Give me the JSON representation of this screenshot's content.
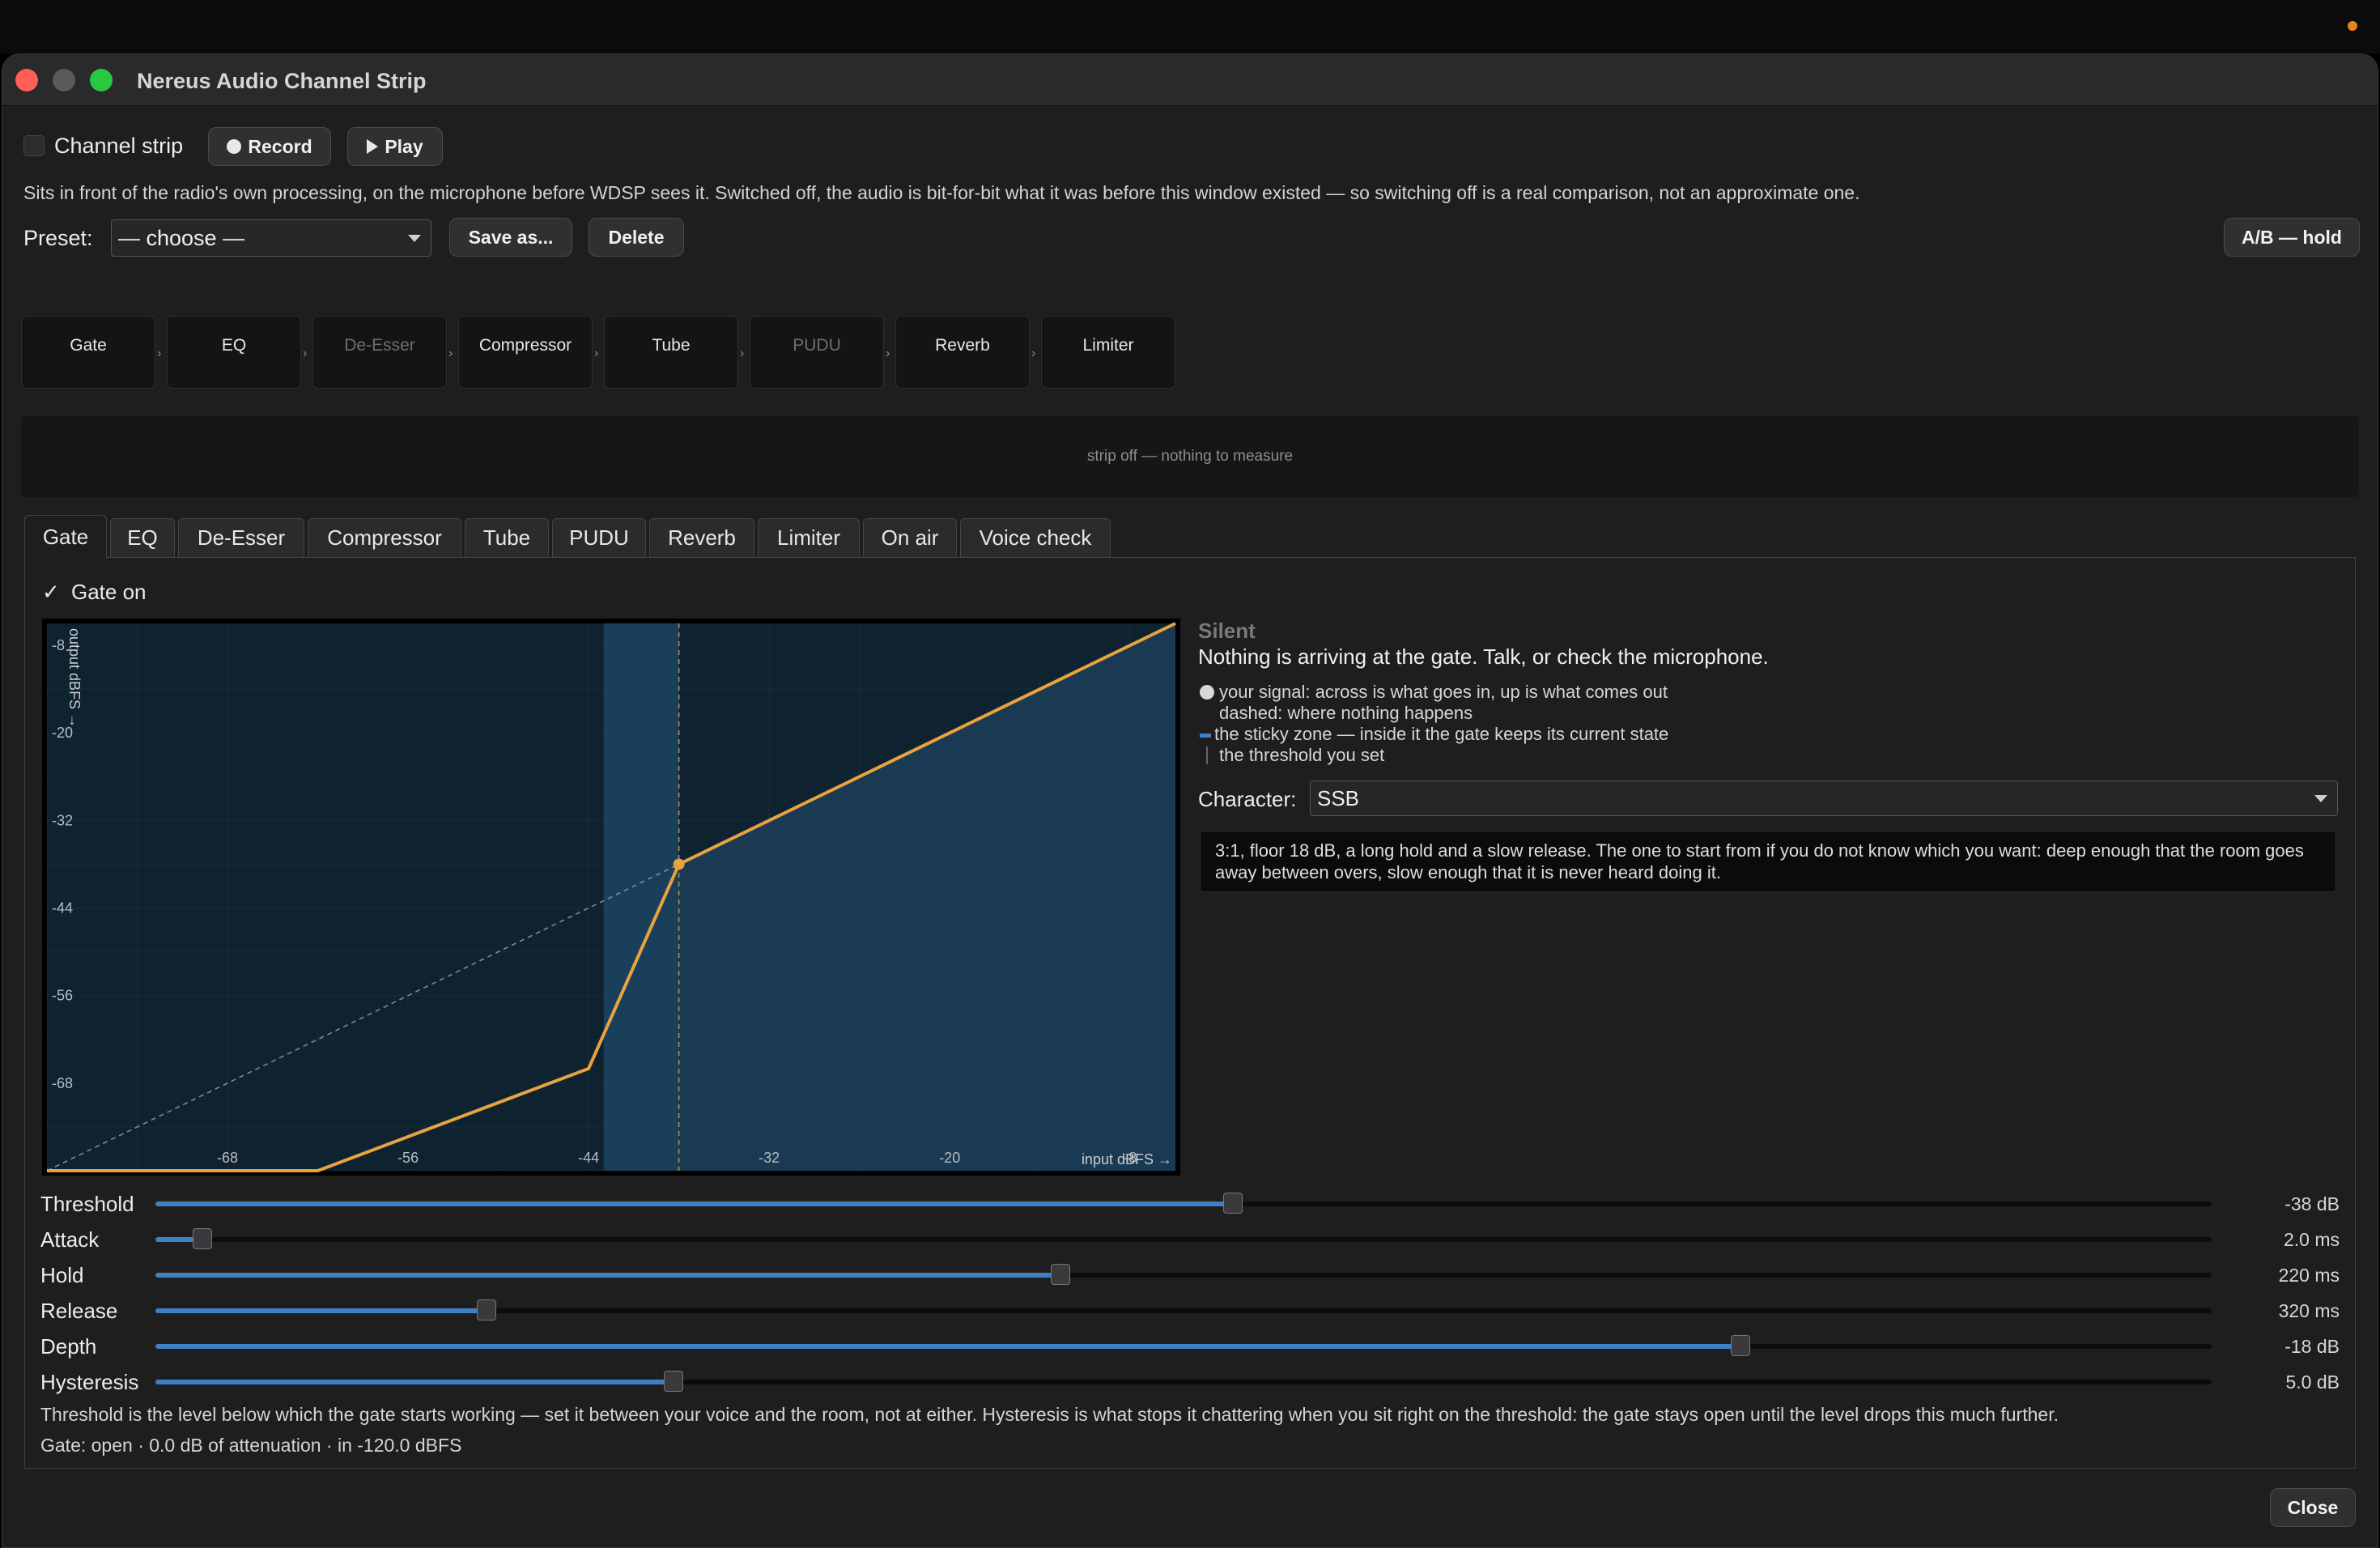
{
  "window": {
    "title": "Nereus Audio Channel Strip"
  },
  "top": {
    "channel_strip_label": "Channel strip",
    "record_label": "Record",
    "play_label": "Play",
    "intro": "Sits in front of the radio's own processing, on the microphone before WDSP sees it. Switched off, the audio is bit-for-bit what it was before this window existed — so switching off is a real comparison, not an approximate one."
  },
  "preset": {
    "label": "Preset:",
    "selected": "— choose —",
    "save_as_label": "Save as...",
    "delete_label": "Delete",
    "ab_label": "A/B — hold"
  },
  "chain": [
    {
      "label": "Gate",
      "enabled": true
    },
    {
      "label": "EQ",
      "enabled": true
    },
    {
      "label": "De-Esser",
      "enabled": false
    },
    {
      "label": "Compressor",
      "enabled": true
    },
    {
      "label": "Tube",
      "enabled": true
    },
    {
      "label": "PUDU",
      "enabled": false
    },
    {
      "label": "Reverb",
      "enabled": true
    },
    {
      "label": "Limiter",
      "enabled": true
    }
  ],
  "chain_arrow": "›",
  "meter": {
    "status": "strip off — nothing to measure"
  },
  "tabs": [
    "Gate",
    "EQ",
    "De-Esser",
    "Compressor",
    "Tube",
    "PUDU",
    "Reverb",
    "Limiter",
    "On air",
    "Voice check"
  ],
  "gate": {
    "enabled_label": "Gate on",
    "status_title": "Silent",
    "status_text": "Nothing is arriving at the gate. Talk, or check the microphone.",
    "legend": {
      "signal": "your signal: across is what goes in, up is what comes out",
      "dashed": "dashed: where nothing happens",
      "sticky": "the sticky zone — inside it the gate keeps its current state",
      "threshold": "the threshold you set"
    },
    "character_label": "Character:",
    "character_value": "SSB",
    "character_desc": "3:1, floor 18 dB, a long hold and a slow release. The one to start from if you do not know which you want: deep enough that the room goes away between overs, slow enough that it is never heard doing it.",
    "sliders": [
      {
        "label": "Threshold",
        "value": "-38 dB",
        "fraction": 0.524
      },
      {
        "label": "Attack",
        "value": "2.0 ms",
        "fraction": 0.023
      },
      {
        "label": "Hold",
        "value": "220 ms",
        "fraction": 0.44
      },
      {
        "label": "Release",
        "value": "320 ms",
        "fraction": 0.161
      },
      {
        "label": "Depth",
        "value": "-18 dB",
        "fraction": 0.771
      },
      {
        "label": "Hysteresis",
        "value": "5.0 dB",
        "fraction": 0.252
      }
    ],
    "help": "Threshold is the level below which the gate starts working — set it between your voice and the room, not at either. Hysteresis is what stops it chattering when you sit right on the threshold: the gate stays open until the level drops this much further.",
    "status_line": "Gate: open · 0.0 dB of attenuation · in -120.0 dBFS"
  },
  "chart_data": {
    "type": "line",
    "xlabel": "input dBFS →",
    "ylabel": "output dBFS →",
    "xlim": [
      -80,
      -5
    ],
    "ylim": [
      -80,
      -5
    ],
    "x_ticks": [
      -68,
      -56,
      -44,
      -32,
      -20,
      -8
    ],
    "y_ticks": [
      -8,
      -20,
      -32,
      -44,
      -56,
      -68
    ],
    "threshold": -38,
    "hysteresis_zone": [
      -43,
      -38
    ],
    "series": [
      {
        "x": [
          -80,
          -62,
          -44,
          -38,
          -5
        ],
        "y": [
          -80,
          -80,
          -66,
          -38,
          -5
        ]
      }
    ],
    "unity_line": {
      "x": [
        -80,
        -38
      ],
      "y": [
        -80,
        -38
      ]
    },
    "colors": {
      "curve": "#e8a340",
      "zone": "#1f4a6a",
      "fill": "#1c3d58",
      "grid": "#2c3e4c"
    }
  },
  "footer": {
    "close_label": "Close"
  }
}
